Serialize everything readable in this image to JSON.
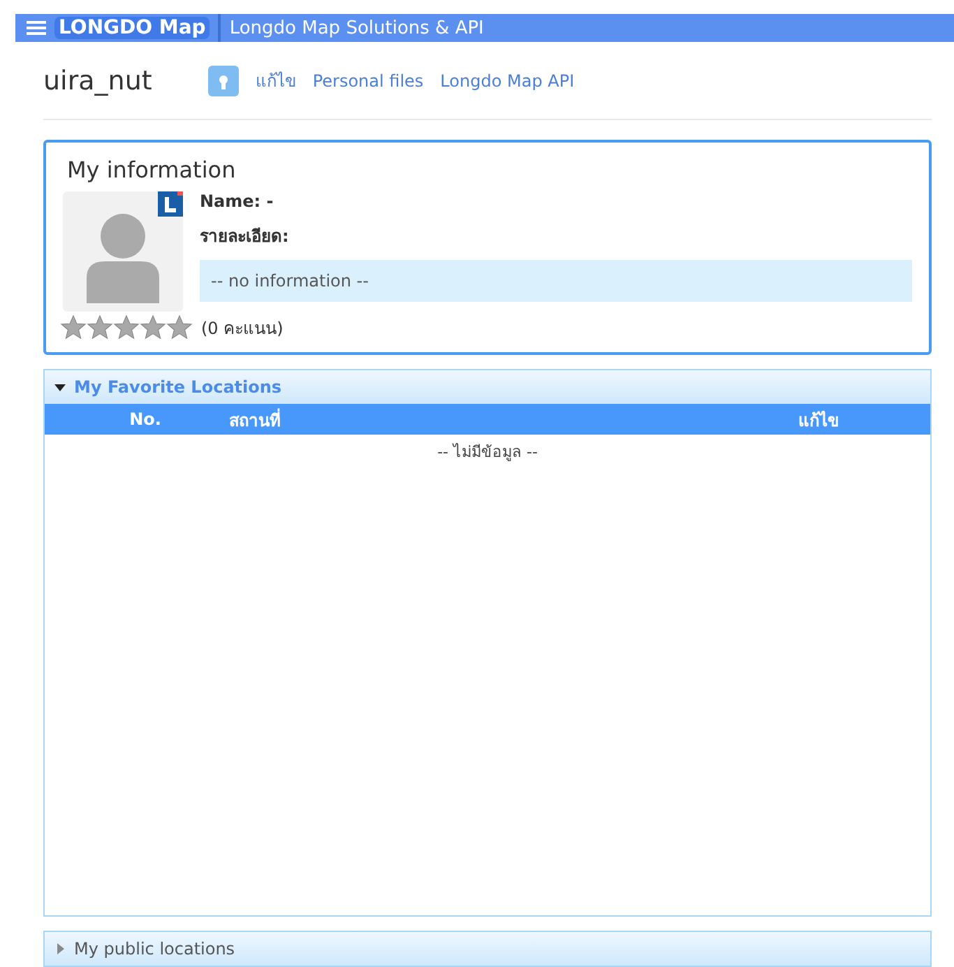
{
  "header": {
    "logo": "LONGDO Map",
    "title": "Longdo Map Solutions & API"
  },
  "user": {
    "username": "uira_nut",
    "nav": [
      {
        "label": "แก้ไข"
      },
      {
        "label": "Personal files"
      },
      {
        "label": "Longdo Map API"
      }
    ]
  },
  "info": {
    "title": "My information",
    "name_label": "Name: -",
    "detail_label": "รายละเอียด:",
    "detail_value": "-- no information --",
    "stars": 0,
    "score": "(0 คะแนน)"
  },
  "panels": [
    {
      "title": "My Favorite Locations",
      "expanded": true,
      "columns": [
        "No.",
        "สถานที่",
        "แก้ไข"
      ],
      "empty": "-- ไม่มีข้อมูล --"
    },
    {
      "title": "My public locations",
      "expanded": false
    }
  ]
}
